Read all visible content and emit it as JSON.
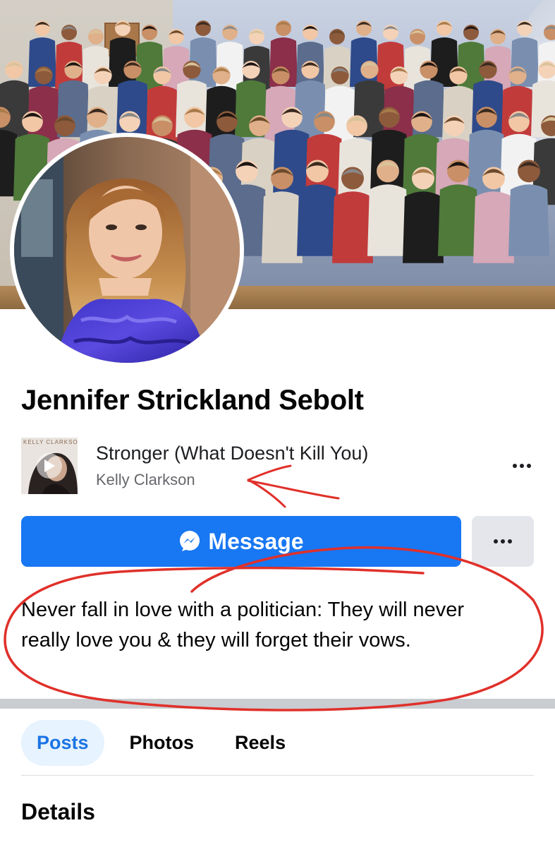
{
  "profile": {
    "name": "Jennifer Strickland Sebolt",
    "bio": "Never fall in love with a politician: They will never really love you & they will forget their vows."
  },
  "music": {
    "song_title": "Stronger (What Doesn't Kill You)",
    "artist": "Kelly Clarkson",
    "album_cover_text": "KELLY CLARKSON"
  },
  "actions": {
    "message_label": "Message",
    "message_icon": "messenger-icon",
    "more_icon": "more-horizontal-icon"
  },
  "tabs": [
    {
      "label": "Posts",
      "active": true
    },
    {
      "label": "Photos",
      "active": false
    },
    {
      "label": "Reels",
      "active": false
    }
  ],
  "sections": {
    "details_title": "Details"
  },
  "colors": {
    "accent": "#1877f2",
    "active_tab_bg": "#e7f3ff",
    "active_tab_text": "#1b74e4",
    "annotation_red": "#e0302a"
  }
}
